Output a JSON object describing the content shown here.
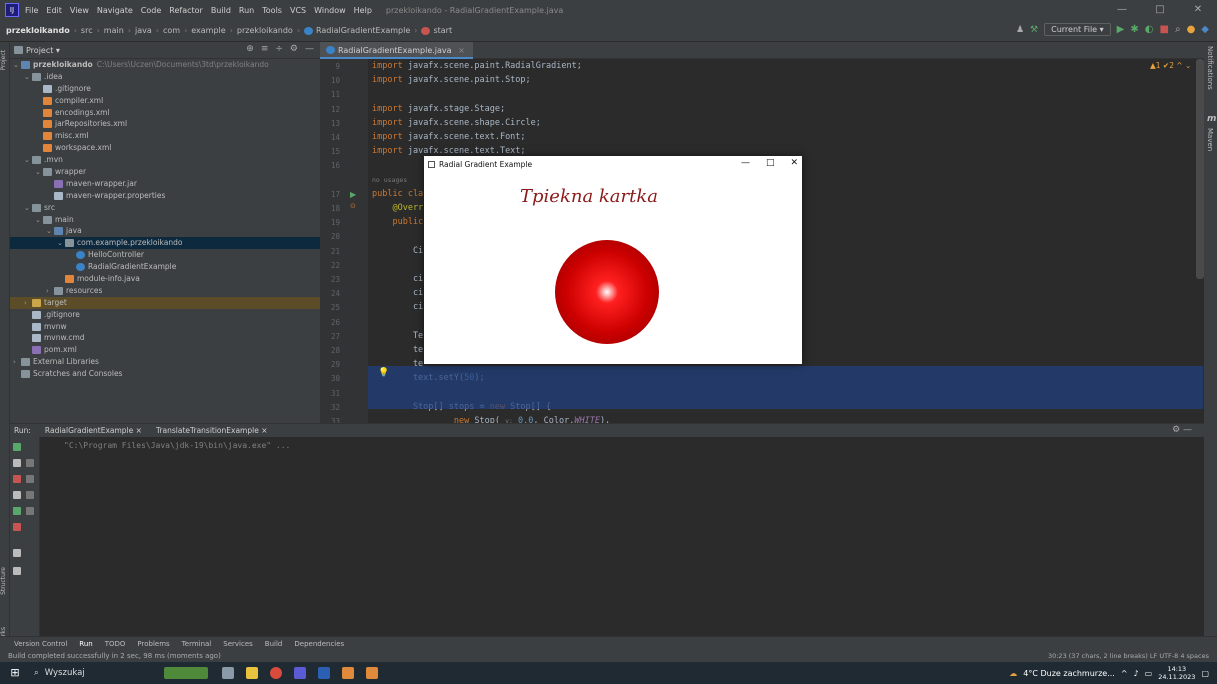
{
  "titlebar": {
    "menu": [
      "File",
      "Edit",
      "View",
      "Navigate",
      "Code",
      "Refactor",
      "Build",
      "Run",
      "Tools",
      "VCS",
      "Window",
      "Help"
    ],
    "title": "przekloikando - RadialGradientExample.java",
    "minimize": "—",
    "maximize": "□",
    "close": "✕"
  },
  "navbar": {
    "breadcrumbs": [
      "przekloikando",
      "src",
      "main",
      "java",
      "com",
      "example",
      "przekloikando",
      "RadialGradientExample",
      "start"
    ],
    "run_config": "Current File ▾"
  },
  "left_stripe": {
    "project": "Project",
    "structure": "Structure",
    "bookmarks": "Bookmarks"
  },
  "right_stripe": {
    "notifications": "Notifications",
    "maven": "Maven",
    "maven_icon": "m"
  },
  "project": {
    "header": "Project ▾",
    "items": [
      {
        "depth": 0,
        "arrow": "⌄",
        "icon": "folder-blue",
        "label": "przekloikando",
        "extra": "C:\\Users\\Uczen\\Documents\\3td\\przekloikando"
      },
      {
        "depth": 1,
        "arrow": "⌄",
        "icon": "folder",
        "label": ".idea",
        "extra": ""
      },
      {
        "depth": 2,
        "arrow": "",
        "icon": "file",
        "label": ".gitignore",
        "extra": ""
      },
      {
        "depth": 2,
        "arrow": "",
        "icon": "xml",
        "label": "compiler.xml",
        "extra": ""
      },
      {
        "depth": 2,
        "arrow": "",
        "icon": "xml",
        "label": "encodings.xml",
        "extra": ""
      },
      {
        "depth": 2,
        "arrow": "",
        "icon": "xml",
        "label": "jarRepositories.xml",
        "extra": ""
      },
      {
        "depth": 2,
        "arrow": "",
        "icon": "xml",
        "label": "misc.xml",
        "extra": ""
      },
      {
        "depth": 2,
        "arrow": "",
        "icon": "xml",
        "label": "workspace.xml",
        "extra": ""
      },
      {
        "depth": 1,
        "arrow": "⌄",
        "icon": "folder",
        "label": ".mvn",
        "extra": ""
      },
      {
        "depth": 2,
        "arrow": "⌄",
        "icon": "folder",
        "label": "wrapper",
        "extra": ""
      },
      {
        "depth": 3,
        "arrow": "",
        "icon": "jar",
        "label": "maven-wrapper.jar",
        "extra": ""
      },
      {
        "depth": 3,
        "arrow": "",
        "icon": "file",
        "label": "maven-wrapper.properties",
        "extra": ""
      },
      {
        "depth": 1,
        "arrow": "⌄",
        "icon": "folder",
        "label": "src",
        "extra": ""
      },
      {
        "depth": 2,
        "arrow": "⌄",
        "icon": "folder",
        "label": "main",
        "extra": ""
      },
      {
        "depth": 3,
        "arrow": "⌄",
        "icon": "folder-blue",
        "label": "java",
        "extra": ""
      },
      {
        "depth": 4,
        "arrow": "⌄",
        "icon": "folder",
        "label": "com.example.przekloikando",
        "extra": "",
        "selected": true
      },
      {
        "depth": 5,
        "arrow": "",
        "icon": "cls",
        "label": "HelloController",
        "extra": ""
      },
      {
        "depth": 5,
        "arrow": "",
        "icon": "cls",
        "label": "RadialGradientExample",
        "extra": ""
      },
      {
        "depth": 4,
        "arrow": "",
        "icon": "xml",
        "label": "module-info.java",
        "extra": ""
      },
      {
        "depth": 3,
        "arrow": "›",
        "icon": "folder",
        "label": "resources",
        "extra": ""
      },
      {
        "depth": 1,
        "arrow": "›",
        "icon": "folder-y",
        "label": "target",
        "extra": "",
        "target": true
      },
      {
        "depth": 1,
        "arrow": "",
        "icon": "file",
        "label": ".gitignore",
        "extra": ""
      },
      {
        "depth": 1,
        "arrow": "",
        "icon": "file",
        "label": "mvnw",
        "extra": ""
      },
      {
        "depth": 1,
        "arrow": "",
        "icon": "file",
        "label": "mvnw.cmd",
        "extra": ""
      },
      {
        "depth": 1,
        "arrow": "",
        "icon": "jar",
        "label": "pom.xml",
        "extra": ""
      },
      {
        "depth": 0,
        "arrow": "›",
        "icon": "folder",
        "label": "External Libraries",
        "extra": ""
      },
      {
        "depth": 0,
        "arrow": "",
        "icon": "folder",
        "label": "Scratches and Consoles",
        "extra": ""
      }
    ]
  },
  "editor": {
    "tab": "RadialGradientExample.java",
    "inspection": "▲1 ✔2 ^ ⌄",
    "lines": [
      {
        "n": "9",
        "html": "<span class='kw'>import</span> javafx.scene.paint.RadialGradient;"
      },
      {
        "n": "10",
        "html": "<span class='kw'>import</span> javafx.scene.paint.Stop;"
      },
      {
        "n": "11",
        "html": ""
      },
      {
        "n": "12",
        "html": "<span class='kw'>import</span> javafx.stage.Stage;"
      },
      {
        "n": "13",
        "html": "<span class='kw'>import</span> javafx.scene.shape.Circle;"
      },
      {
        "n": "14",
        "html": "<span class='kw'>import</span> javafx.scene.text.Font;"
      },
      {
        "n": "15",
        "html": "<span class='kw'>import</span> javafx.scene.text.Text;"
      },
      {
        "n": "16",
        "html": ""
      },
      {
        "n": "",
        "html": "<span class='hint'>no usages</span>"
      },
      {
        "n": "17",
        "html": "<span class='kw'>public class</span>"
      },
      {
        "n": "18",
        "html": "    <span class='ann'>@Overr</span>"
      },
      {
        "n": "19",
        "html": "    <span class='kw'>public</span>"
      },
      {
        "n": "20",
        "html": ""
      },
      {
        "n": "21",
        "html": "        Ci"
      },
      {
        "n": "22",
        "html": ""
      },
      {
        "n": "23",
        "html": "        ci"
      },
      {
        "n": "24",
        "html": "        ci"
      },
      {
        "n": "25",
        "html": "        ci"
      },
      {
        "n": "26",
        "html": ""
      },
      {
        "n": "27",
        "html": "        Te"
      },
      {
        "n": "28",
        "html": "        te"
      },
      {
        "n": "29",
        "html": "        te"
      },
      {
        "n": "30",
        "html": "        text.setY(<span class='num'>50</span>);"
      },
      {
        "n": "31",
        "html": ""
      },
      {
        "n": "32",
        "html": "        Stop[] stops = <span class='kw'>new</span> Stop[] {"
      },
      {
        "n": "33",
        "html": "                <span class='kw'>new</span> Stop( <span class='hint'>v:</span> <span class='num'>0.0</span>, Color.<span class='fld'>WHITE</span>),"
      }
    ]
  },
  "fx_window": {
    "title": "Radial Gradient Example",
    "minimize": "—",
    "maximize": "□",
    "close": "✕",
    "text": "Tpiekna kartka"
  },
  "run": {
    "label": "Run:",
    "tabs": [
      "RadialGradientExample ×",
      "TranslateTransitionExample ×"
    ],
    "command": "\"C:\\Program Files\\Java\\jdk-19\\bin\\java.exe\" ..."
  },
  "toolwindows": [
    "Version Control",
    "Run",
    "TODO",
    "Problems",
    "Terminal",
    "Services",
    "Build",
    "Dependencies"
  ],
  "status": {
    "message": "Build completed successfully in 2 sec, 98 ms (moments ago)",
    "right": "30:23 (37 chars, 2 line breaks)   LF   UTF-8   4 spaces"
  },
  "taskbar": {
    "search": "Wyszukaj",
    "weather": "4°C  Duze zachmurze...",
    "time": "14:13",
    "date": "24.11.2023"
  }
}
